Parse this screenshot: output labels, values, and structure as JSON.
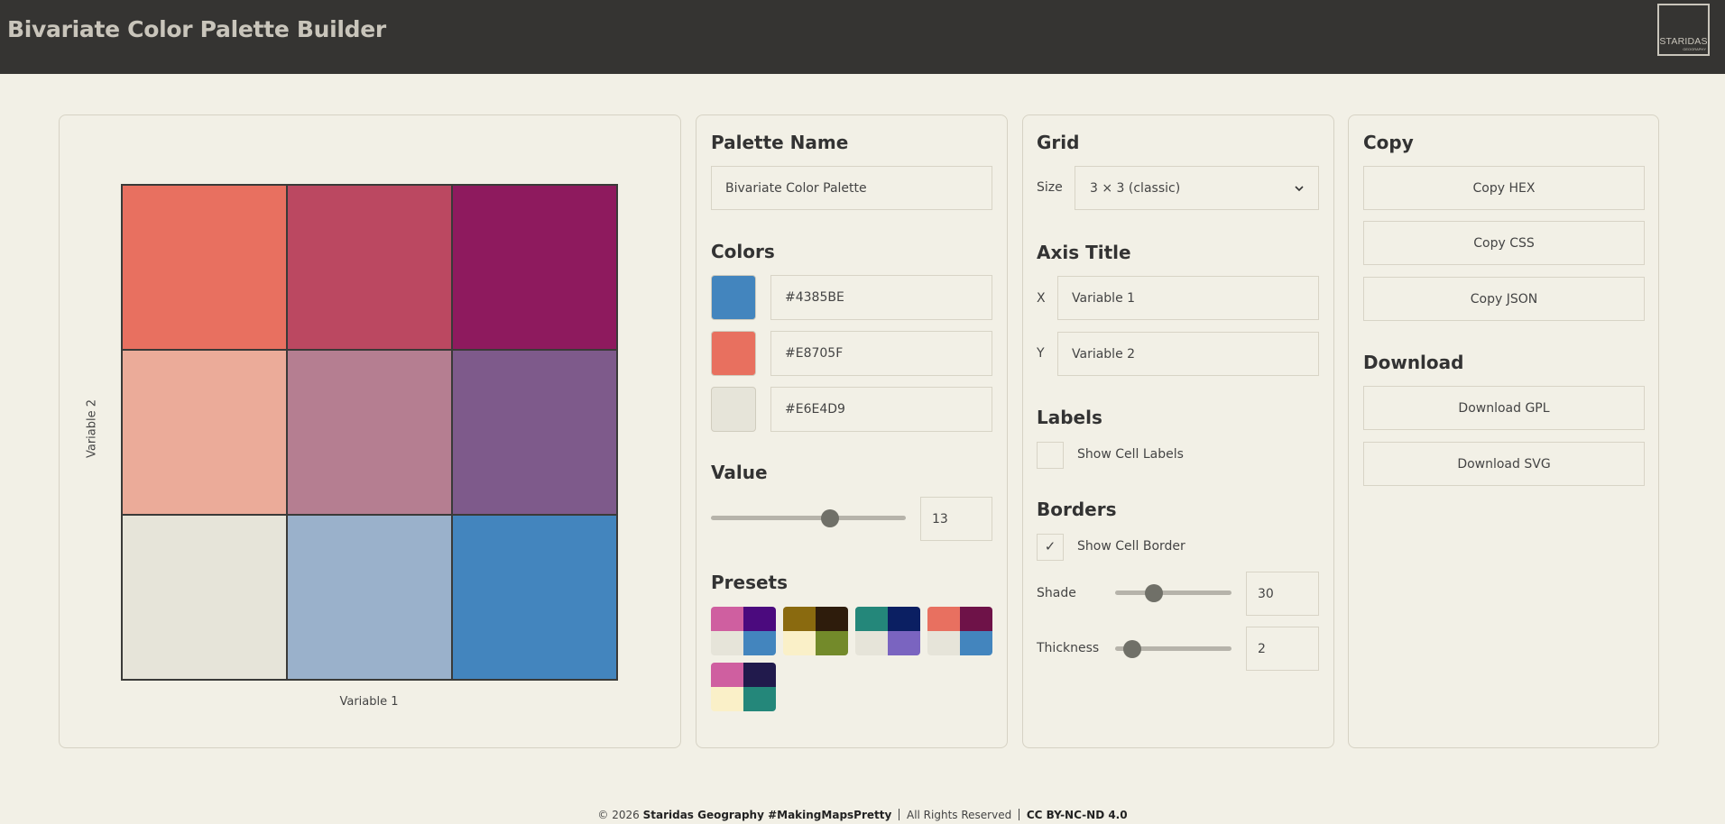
{
  "header": {
    "title": "Bivariate Color Palette Builder",
    "logo_line1": "STARIDAS",
    "logo_line2": "GEOGRAPHY"
  },
  "preview": {
    "x_axis_label": "Variable 1",
    "y_axis_label": "Variable 2",
    "cells": [
      [
        "#e87060",
        "#bb4861",
        "#8e1a5e"
      ],
      [
        "#ebab99",
        "#b57e91",
        "#7e5a8b"
      ],
      [
        "#e6e4d9",
        "#9ab1cb",
        "#4385be"
      ]
    ]
  },
  "palette": {
    "name_heading": "Palette Name",
    "name_value": "Bivariate Color Palette",
    "colors_heading": "Colors",
    "colors": [
      {
        "swatch": "#4385BE",
        "hex": "#4385BE"
      },
      {
        "swatch": "#E8705F",
        "hex": "#E8705F"
      },
      {
        "swatch": "#E6E4D9",
        "hex": "#E6E4D9"
      }
    ],
    "value_heading": "Value",
    "value": "13",
    "value_level": 0.62,
    "presets_heading": "Presets",
    "presets": [
      [
        "#cf5fa0",
        "#4b0a7e",
        "#e6e4d9",
        "#4385be"
      ],
      [
        "#8a6a0f",
        "#2e1c0c",
        "#faf0c8",
        "#738a2a"
      ],
      [
        "#24877a",
        "#0b1f62",
        "#e6e4d9",
        "#7a64c0"
      ],
      [
        "#e87060",
        "#6e1248",
        "#e6e4d9",
        "#4385be"
      ],
      [
        "#cf5fa0",
        "#211a4c",
        "#faf0c8",
        "#24877a"
      ]
    ]
  },
  "grid": {
    "grid_heading": "Grid",
    "size_label": "Size",
    "size_value": "3 × 3 (classic)",
    "axis_heading": "Axis Title",
    "x_label": "X",
    "x_value": "Variable 1",
    "y_label": "Y",
    "y_value": "Variable 2",
    "labels_heading": "Labels",
    "show_cell_labels": "Show Cell Labels",
    "borders_heading": "Borders",
    "show_cell_border": "Show Cell Border",
    "check_mark": "✓",
    "shade_label": "Shade",
    "shade_value": "30",
    "shade_level": 0.3,
    "thickness_label": "Thickness",
    "thickness_value": "2",
    "thickness_level": 0.08
  },
  "copy": {
    "copy_heading": "Copy",
    "copy_hex": "Copy HEX",
    "copy_css": "Copy CSS",
    "copy_json": "Copy JSON",
    "download_heading": "Download",
    "download_gpl": "Download GPL",
    "download_svg": "Download SVG"
  },
  "footer": {
    "copyright": "© 2026",
    "brand": "Staridas Geography #MakingMapsPretty",
    "rights": "All Rights Reserved",
    "license": "CC BY-NC-ND 4.0"
  }
}
